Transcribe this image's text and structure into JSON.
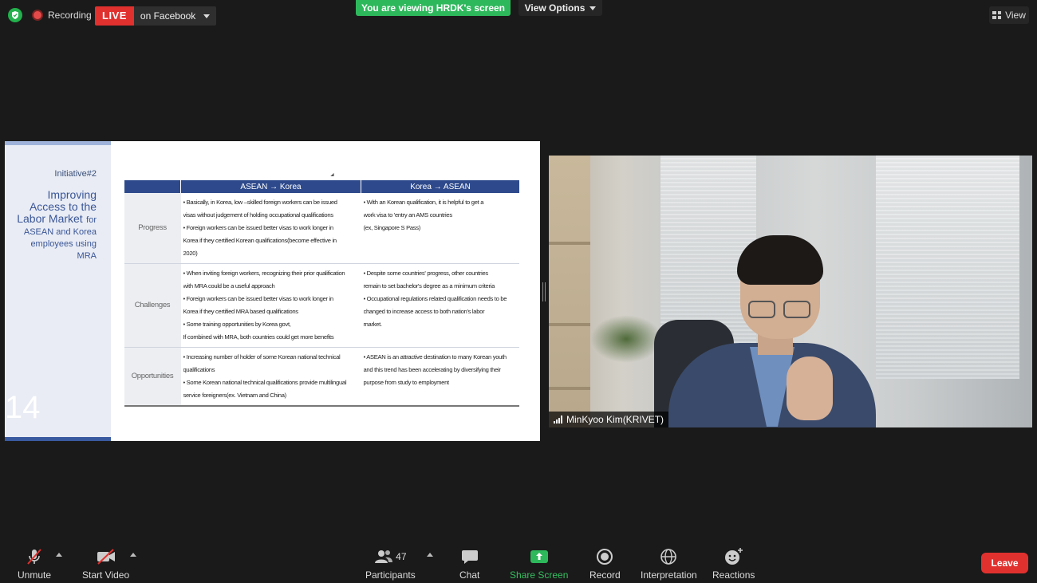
{
  "topbar": {
    "recording_label": "Recording",
    "live_badge": "LIVE",
    "live_destination": "on Facebook",
    "viewing_banner": "You are viewing HRDK's screen",
    "view_options_label": "View Options",
    "view_label": "View"
  },
  "slide": {
    "initiative": "Initiative#2",
    "title_line1": "Improving",
    "title_line2": "Access to the",
    "title_line3": "Labor Market",
    "title_for": "for",
    "title_line4": "ASEAN and Korea",
    "title_line5": "employees using",
    "title_line6": "MRA",
    "page_number": "14",
    "table": {
      "headers": [
        "ASEAN → Korea",
        "Korea → ASEAN"
      ],
      "rows": [
        {
          "label": "Progress",
          "c1": [
            "• Basically, in Korea, low –skilled foreign workers can be issued",
            "   visas without judgement of holding occupational qualifications",
            "• Foreign workers can be issued better visas to work longer  in",
            "   Korea if they certified Korean qualifications(become effective in",
            "   2020)"
          ],
          "c2": [
            "• With an Korean qualification, it is helpful to get a",
            "   work  visa to 'entry an AMS countries",
            "   (ex, Singapore S Pass)"
          ]
        },
        {
          "label": "Challenges",
          "c1": [
            "• When inviting foreign workers, recognizing  their prior qualification",
            "  with MRA could be a useful approach",
            "• Foreign workers can be issued better visas to work longer  in",
            "   Korea if they certified MRA based qualifications",
            "• Some training opportunities  by Korea govt,",
            "   If combined with MRA, both  countries could get more  benefits"
          ],
          "c2": [
            "• Despite  some countries' progress, other countries",
            "   remain to set  bachelor's degree as a minimum criteria",
            "• Occupational regulations related qualification needs to be",
            "   changed to increase access to both  nation's labor",
            "   market."
          ]
        },
        {
          "label": "Opportunities",
          "c1": [
            "•  Increasing number of holder of some Korean national technical",
            "    qualifications",
            "•  Some Korean national technical qualifications provide multilingual",
            "service foreigners(ex. Vietnam and China)"
          ],
          "c2": [
            "• ASEAN is an attractive destination to many Korean youth",
            "and this trend has been accelerating by diversifying their",
            "purpose from study to employment"
          ]
        }
      ]
    }
  },
  "video": {
    "participant_name": "MinKyoo Kim(KRIVET)"
  },
  "toolbar": {
    "unmute": "Unmute",
    "start_video": "Start Video",
    "participants": "Participants",
    "participant_count": "47",
    "chat": "Chat",
    "share_screen": "Share Screen",
    "record": "Record",
    "interpretation": "Interpretation",
    "reactions": "Reactions",
    "leave": "Leave"
  },
  "colors": {
    "live_red": "#e0312f",
    "share_green": "#2eb85c",
    "table_header": "#2e4a8c"
  }
}
